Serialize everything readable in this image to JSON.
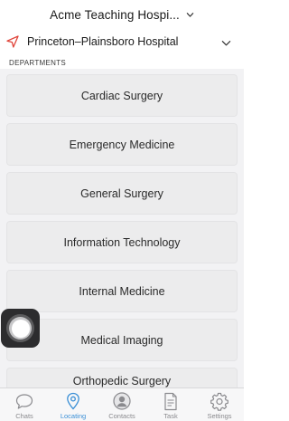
{
  "header": {
    "org_title": "Acme Teaching Hospi...",
    "chevron_icon": "chevron-down-icon"
  },
  "hospital": {
    "name": "Princeton–Plainsboro Hospital",
    "location_icon": "location-arrow-icon",
    "location_icon_color": "#e0443a",
    "chevron_icon": "chevron-down-icon"
  },
  "section_label": "DEPARTMENTS",
  "departments": [
    "Cardiac Surgery",
    "Emergency Medicine",
    "General Surgery",
    "Information Technology",
    "Internal Medicine",
    "Medical Imaging",
    "Orthopedic Surgery"
  ],
  "floating_button_icon": "assistive-touch-icon",
  "tabs": [
    {
      "label": "Chats",
      "icon": "chat-bubble-icon",
      "active": false
    },
    {
      "label": "Locating",
      "icon": "location-pin-icon",
      "active": true
    },
    {
      "label": "Contacts",
      "icon": "contacts-icon",
      "active": false
    },
    {
      "label": "Task",
      "icon": "task-document-icon",
      "active": false
    },
    {
      "label": "Settings",
      "icon": "gear-icon",
      "active": false
    }
  ],
  "colors": {
    "accent": "#3a8fd6",
    "inactive_tab": "#8a8a8e",
    "location_red": "#e0443a",
    "list_background": "#f2f2f4",
    "button_background": "#ececed"
  }
}
